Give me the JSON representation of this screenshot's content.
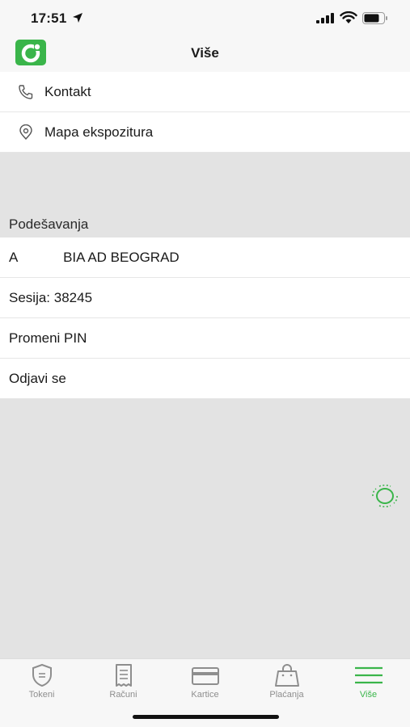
{
  "status_bar": {
    "time": "17:51"
  },
  "nav": {
    "title": "Više"
  },
  "menu": {
    "contact": "Kontakt",
    "branches": "Mapa ekspozitura"
  },
  "settings": {
    "header": "Podešavanja",
    "account_name": "A            BIA AD BEOGRAD",
    "session": "Sesija: 38245",
    "change_pin": "Promeni PIN",
    "logout": "Odjavi se"
  },
  "tabs": [
    {
      "label": "Tokeni",
      "icon": "shield-icon"
    },
    {
      "label": "Računi",
      "icon": "receipt-icon"
    },
    {
      "label": "Kartice",
      "icon": "card-icon"
    },
    {
      "label": "Plaćanja",
      "icon": "bag-icon"
    },
    {
      "label": "Više",
      "icon": "menu-icon"
    }
  ],
  "colors": {
    "accent": "#3ab54a",
    "background": "#e3e3e3"
  }
}
